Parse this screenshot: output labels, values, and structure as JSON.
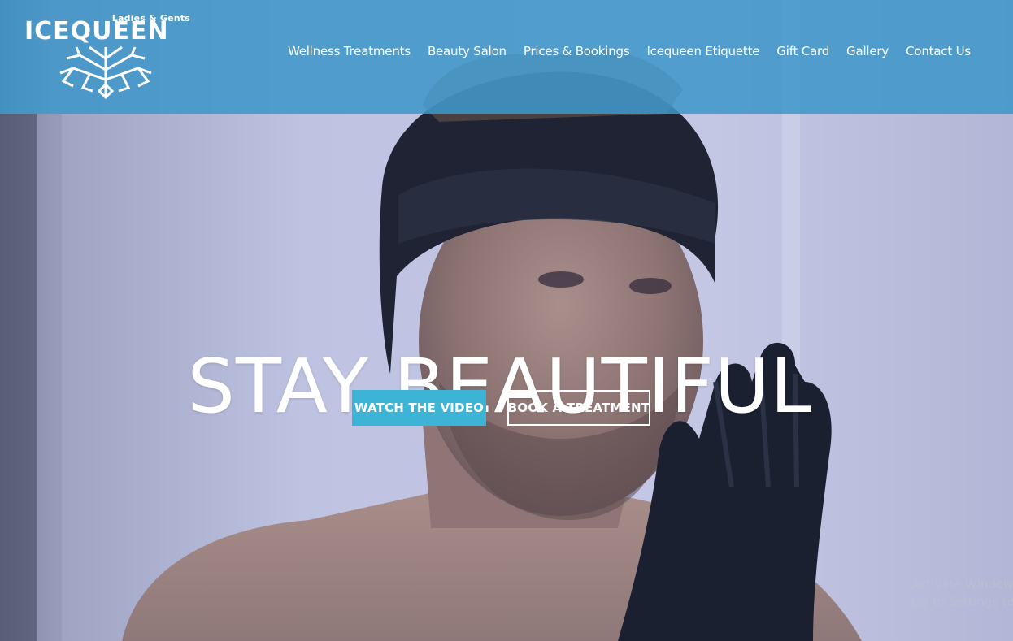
{
  "brand": {
    "tagline": "Ladies & Gents",
    "wordmark": "ICEQUEEN"
  },
  "nav": {
    "items": [
      {
        "label": "Wellness Treatments"
      },
      {
        "label": "Beauty Salon"
      },
      {
        "label": "Prices & Bookings"
      },
      {
        "label": "Icequeen Etiquette"
      },
      {
        "label": "Gift Card"
      },
      {
        "label": "Gallery"
      },
      {
        "label": "Contact Us"
      }
    ]
  },
  "hero": {
    "headline": "STAY BEAUTIFUL",
    "primary_button": "WATCH THE VIDEO",
    "secondary_button": "BOOK A TREATMENT"
  },
  "watermark": {
    "line1": "Activate Windows",
    "line2": "Go to Settings to"
  },
  "colors": {
    "header_bg": "#3e96ca",
    "accent_button": "#3bb4d6",
    "text": "#ffffff"
  }
}
